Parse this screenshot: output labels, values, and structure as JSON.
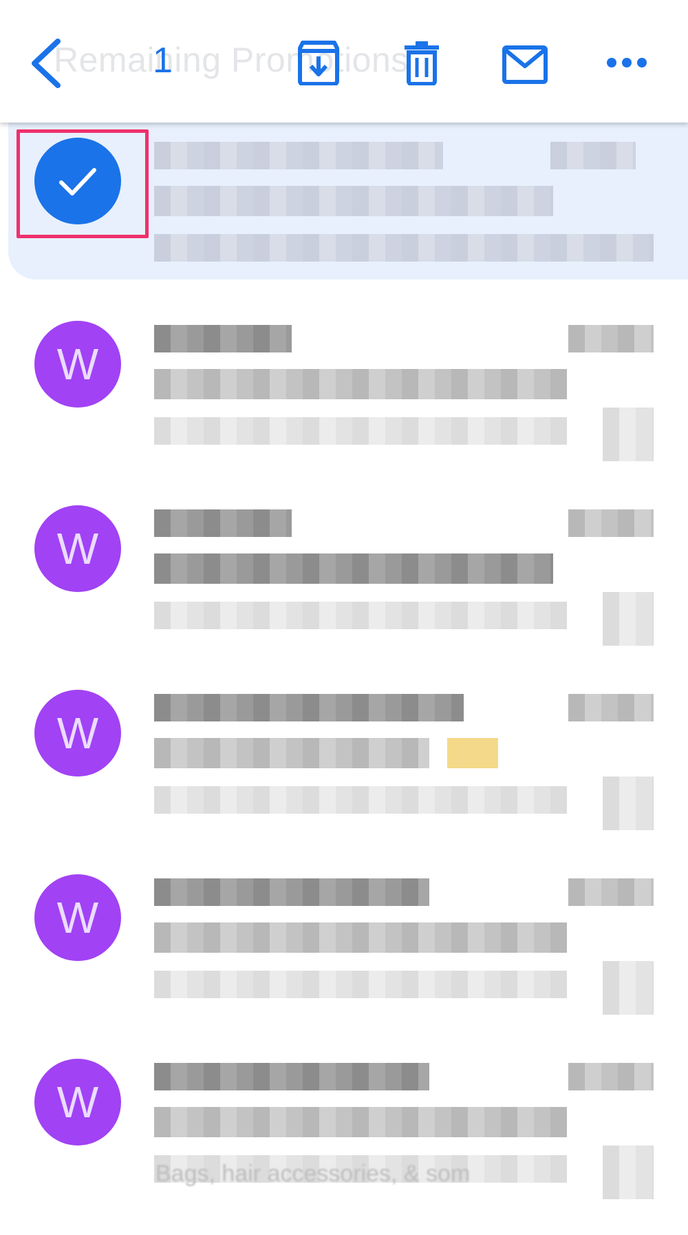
{
  "header": {
    "title": "Remaining Promotions",
    "selected_count": "1",
    "icons": {
      "back": "back-arrow-icon",
      "archive": "archive-icon",
      "delete": "trash-icon",
      "mark_unread": "mail-icon",
      "more": "more-horiz-icon"
    },
    "accent_color": "#1a73e8"
  },
  "messages": [
    {
      "avatar_letter": "",
      "selected": true
    },
    {
      "avatar_letter": "W",
      "selected": false
    },
    {
      "avatar_letter": "W",
      "selected": false
    },
    {
      "avatar_letter": "W",
      "selected": false
    },
    {
      "avatar_letter": "W",
      "selected": false
    },
    {
      "avatar_letter": "W",
      "selected": false
    }
  ],
  "colors": {
    "avatar_purple": "#a142f4",
    "selected_bg": "#e8f0fe",
    "highlight": "#f0306c"
  },
  "bottom_snippet": "Bags, hair accessories, & som"
}
